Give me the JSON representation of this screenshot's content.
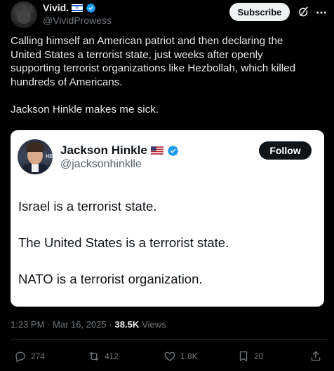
{
  "post": {
    "display_name": "Vivid.",
    "handle": "@VividProwess",
    "subscribe_label": "Subscribe",
    "text": "Calling himself an American patriot and then declaring the\nUnited States a terrorist state, just weeks after openly\nsupporting terrorist organizations like Hezbollah, which killed\nhundreds of Americans.\n\nJackson Hinkle makes me sick.",
    "timestamp": "1:23 PM · Mar 16, 2025 · ",
    "views_count": "38.5K",
    "views_label": "Views"
  },
  "quote": {
    "name": "Jackson Hinkle",
    "handle": "@jacksonhinklle",
    "follow_label": "Follow",
    "avatar_text": "HB",
    "lines": [
      "Israel is a terrorist state.",
      "The United States is a terrorist state.",
      "NATO is a terrorist organization."
    ]
  },
  "actions": {
    "replies": "274",
    "reposts": "412",
    "likes": "1.8K",
    "bookmarks": "20"
  },
  "colors": {
    "background": "#000000",
    "text": "#e7e9ea",
    "muted": "#71767b",
    "verified": "#1d9bf0",
    "card": "#ffffff"
  },
  "icons": [
    "avatar-cat",
    "israel-flag-icon",
    "verified-badge-icon",
    "grok-icon",
    "more-icon",
    "us-flag-icon",
    "reply-icon",
    "repost-icon",
    "like-icon",
    "bookmark-icon",
    "share-icon"
  ]
}
